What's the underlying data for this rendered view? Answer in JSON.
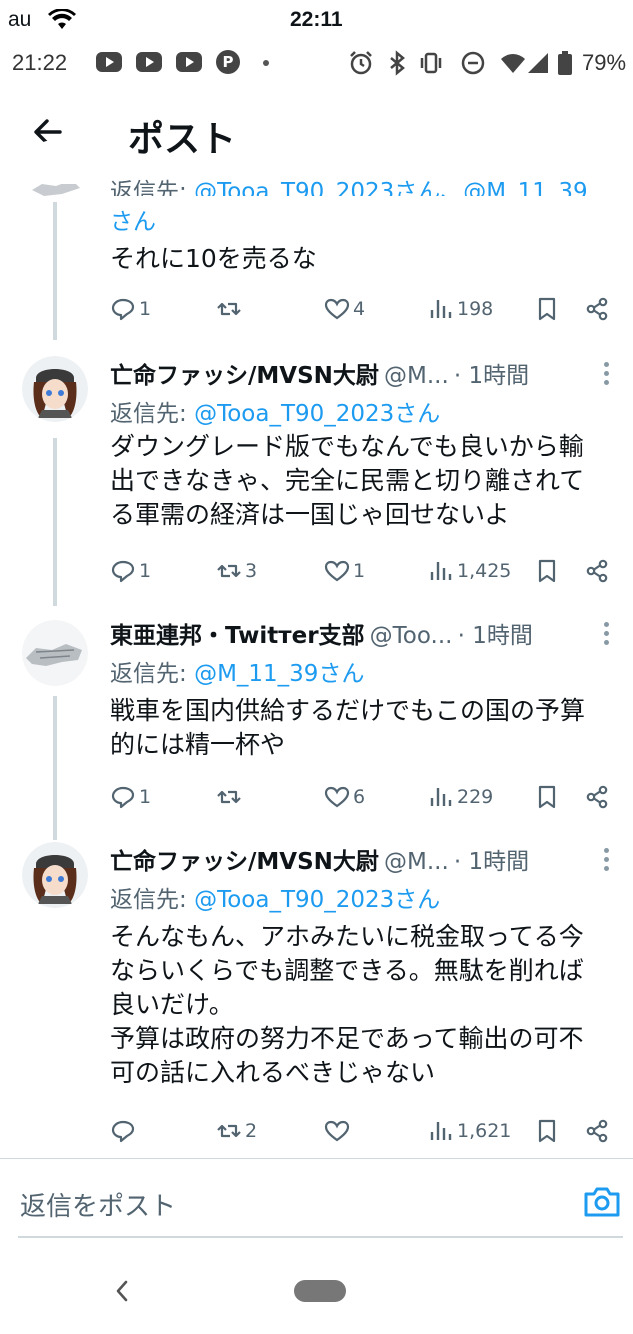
{
  "ios_status": {
    "carrier": "au",
    "time": "22:11"
  },
  "android_status": {
    "time": "21:22",
    "battery": "79%"
  },
  "header": {
    "title": "ポスト"
  },
  "tweets": [
    {
      "reply_to_prefix": "返信先: ",
      "reply_to_handle_partial": "@Tooa_T90_2023さん、@M_11_39",
      "reply_to_line2": "さん",
      "text": "それに10を売るな",
      "replies": "1",
      "reposts": "",
      "likes": "4",
      "views": "198"
    },
    {
      "name": "亡命ファッシ/MVSN大尉",
      "handle": "@M...",
      "time": "· 1時間",
      "reply_to_prefix": "返信先: ",
      "reply_to_handle": "@Tooa_T90_2023さん",
      "text": "ダウングレード版でもなんでも良いから輸\n出できなきゃ、完全に民需と切り離されて\nる軍需の経済は一国じゃ回せないよ",
      "replies": "1",
      "reposts": "3",
      "likes": "1",
      "views": "1,425"
    },
    {
      "name": "東亜連邦・Twitтer支部",
      "handle": "@Too...",
      "time": "· 1時間",
      "reply_to_prefix": "返信先: ",
      "reply_to_handle": "@M_11_39さん",
      "text": "戦車を国内供給するだけでもこの国の予算\n的には精一杯や",
      "replies": "1",
      "reposts": "",
      "likes": "6",
      "views": "229"
    },
    {
      "name": "亡命ファッシ/MVSN大尉",
      "handle": "@M...",
      "time": "· 1時間",
      "reply_to_prefix": "返信先: ",
      "reply_to_handle": "@Tooa_T90_2023さん",
      "text": "そんなもん、アホみたいに税金取ってる今\nならいくらでも調整できる。無駄を削れば\n良いだけ。\n予算は政府の努力不足であって輸出の可不\n可の話に入れるべきじゃない",
      "replies": "",
      "reposts": "2",
      "likes": "",
      "views": "1,621"
    }
  ],
  "compose": {
    "placeholder": "返信をポスト"
  },
  "icons": {
    "brand_blue": "#1d9bf0",
    "action_gray": "#536471"
  }
}
